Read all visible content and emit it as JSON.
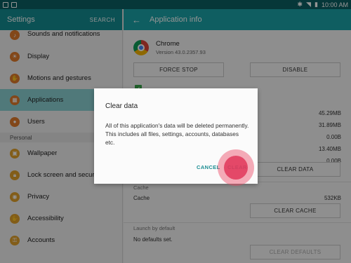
{
  "status_bar": {
    "time": "10:00 AM"
  },
  "left": {
    "title": "Settings",
    "search": "SEARCH",
    "items": [
      {
        "label": "Sounds and notifications",
        "color": "#e07a2b"
      },
      {
        "label": "Display",
        "color": "#e07a2b"
      },
      {
        "label": "Motions and gestures",
        "color": "#e07a2b"
      },
      {
        "label": "Applications",
        "color": "#e07a2b"
      },
      {
        "label": "Users",
        "color": "#e07a2b"
      }
    ],
    "section": "Personal",
    "items2": [
      {
        "label": "Wallpaper",
        "color": "#e0a02b"
      },
      {
        "label": "Lock screen and security",
        "color": "#e0a02b"
      },
      {
        "label": "Privacy",
        "color": "#e0a02b"
      },
      {
        "label": "Accessibility",
        "color": "#e0a02b"
      },
      {
        "label": "Accounts",
        "color": "#e0a02b"
      }
    ]
  },
  "right": {
    "title": "Application info",
    "app_name": "Chrome",
    "version": "Version 43.0.2357.93",
    "force_stop": "FORCE STOP",
    "disable": "DISABLE",
    "storage_values": [
      "45.29MB",
      "31.89MB",
      "0.00B",
      "13.40MB",
      "0.00B"
    ],
    "clear_data": "CLEAR DATA",
    "cache_section": "Cache",
    "cache_label": "Cache",
    "cache_value": "532KB",
    "clear_cache": "CLEAR CACHE",
    "launch_section": "Launch by default",
    "launch_value": "No defaults set.",
    "clear_defaults": "CLEAR DEFAULTS"
  },
  "dialog": {
    "title": "Clear data",
    "message": "All of this application's data will be deleted permanently. This includes all files, settings, accounts, databases etc.",
    "cancel": "CANCEL",
    "clear": "CLEAR"
  }
}
